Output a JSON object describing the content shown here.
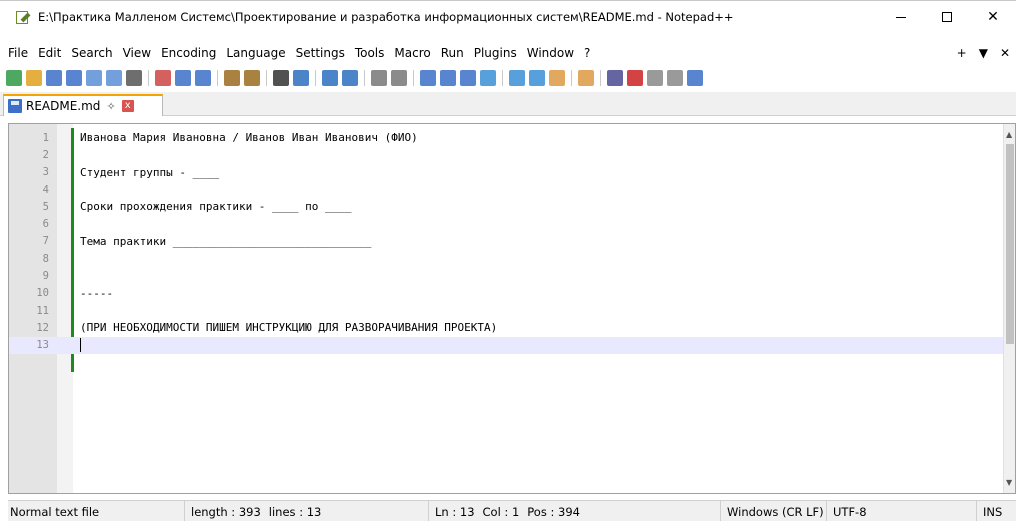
{
  "window": {
    "title": "E:\\Практика Малленом Системс\\Проектирование и разработка информационных систем\\README.md - Notepad++",
    "minimize": "—",
    "maximize": "☐",
    "close": "✕"
  },
  "menu": {
    "items": [
      "File",
      "Edit",
      "Search",
      "View",
      "Encoding",
      "Language",
      "Settings",
      "Tools",
      "Macro",
      "Run",
      "Plugins",
      "Window",
      "?"
    ],
    "right": [
      "+",
      "▼",
      "✕"
    ]
  },
  "toolbar": {
    "icons": [
      "new-file-icon",
      "open-file-icon",
      "save-icon",
      "save-all-icon",
      "close-icon",
      "close-all-icon",
      "print-icon",
      "cut-icon",
      "copy-icon",
      "paste-icon",
      "undo-icon",
      "redo-icon",
      "find-icon",
      "replace-icon",
      "zoom-in-icon",
      "zoom-out-icon",
      "sync-vertical-icon",
      "sync-horizontal-icon",
      "word-wrap-icon",
      "show-all-chars-icon",
      "indent-guide-icon",
      "language-icon",
      "doc-map-icon",
      "function-list-icon",
      "folder-workspace-icon",
      "monitoring-icon",
      "record-macro-icon",
      "stop-macro-icon",
      "play-macro-icon",
      "run-macro-multiple-icon",
      "save-macro-icon"
    ]
  },
  "tab": {
    "label": "README.md",
    "pin": "✧",
    "close": "x"
  },
  "editor": {
    "lines": [
      {
        "n": "1",
        "text": "Иванова Мария Ивановна / Иванов Иван Иванович (ФИО)"
      },
      {
        "n": "2",
        "text": ""
      },
      {
        "n": "3",
        "text": "Студент группы - ____"
      },
      {
        "n": "4",
        "text": ""
      },
      {
        "n": "5",
        "text": "Сроки прохождения практики - ____ по ____"
      },
      {
        "n": "6",
        "text": ""
      },
      {
        "n": "7",
        "text": "Тема практики ______________________________"
      },
      {
        "n": "8",
        "text": ""
      },
      {
        "n": "9",
        "text": ""
      },
      {
        "n": "10",
        "text": "-----"
      },
      {
        "n": "11",
        "text": ""
      },
      {
        "n": "12",
        "text": "(ПРИ НЕОБХОДИМОСТИ ПИШЕМ ИНСТРУКЦИЮ ДЛЯ РАЗВОРАЧИВАНИЯ ПРОЕКТА)"
      },
      {
        "n": "13",
        "text": ""
      }
    ],
    "current_line": 13
  },
  "status": {
    "file_type": "Normal text file",
    "length": "length : 393",
    "lines": "lines : 13",
    "ln": "Ln : 13",
    "col": "Col : 1",
    "pos": "Pos : 394",
    "eol": "Windows (CR LF)",
    "encoding": "UTF-8",
    "mode": "INS"
  },
  "colors": {
    "tab_accent": "#f4a300",
    "change_bar": "#1e8a1e",
    "current_line": "#e8e8ff"
  }
}
